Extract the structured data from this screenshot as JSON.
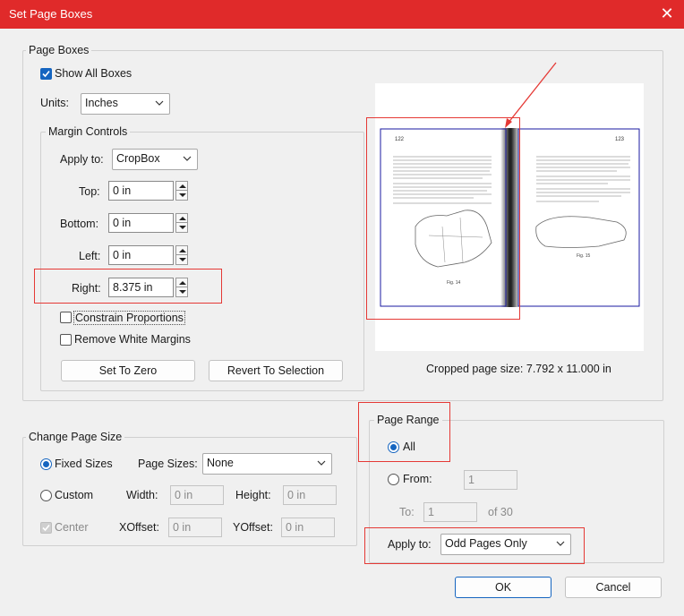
{
  "window": {
    "title": "Set Page Boxes"
  },
  "page_boxes": {
    "legend": "Page Boxes",
    "show_all_boxes": {
      "label": "Show All Boxes",
      "checked": true
    },
    "units": {
      "label": "Units:",
      "value": "Inches"
    },
    "margin_controls": {
      "legend": "Margin Controls",
      "apply_to": {
        "label": "Apply to:",
        "value": "CropBox"
      },
      "top": {
        "label": "Top:",
        "value": "0 in"
      },
      "bottom": {
        "label": "Bottom:",
        "value": "0 in"
      },
      "left": {
        "label": "Left:",
        "value": "0 in"
      },
      "right": {
        "label": "Right:",
        "value": "8.375 in"
      },
      "constrain": {
        "label": "Constrain Proportions",
        "checked": false
      },
      "remove_white": {
        "label": "Remove White Margins",
        "checked": false
      },
      "set_to_zero": "Set To Zero",
      "revert": "Revert To Selection"
    },
    "preview": {
      "cropped_size": "Cropped page size: 7.792 x 11.000 in",
      "left_page_number": "122",
      "right_page_number": "123",
      "left_caption": "Fig. 14",
      "right_caption": "Fig. 15"
    }
  },
  "change_page_size": {
    "legend": "Change Page Size",
    "fixed_sizes": {
      "label": "Fixed Sizes",
      "selected": true
    },
    "page_sizes": {
      "label": "Page Sizes:",
      "value": "None"
    },
    "custom": {
      "label": "Custom",
      "selected": false
    },
    "width": {
      "label": "Width:",
      "value": "0 in"
    },
    "height": {
      "label": "Height:",
      "value": "0 in"
    },
    "center": {
      "label": "Center",
      "checked": true
    },
    "xoffset": {
      "label": "XOffset:",
      "value": "0 in"
    },
    "yoffset": {
      "label": "YOffset:",
      "value": "0 in"
    }
  },
  "page_range": {
    "legend": "Page Range",
    "all": {
      "label": "All",
      "selected": true
    },
    "from": {
      "label": "From:",
      "value": "1"
    },
    "to": {
      "label": "To:",
      "value": "1"
    },
    "of": "of 30",
    "apply_to": {
      "label": "Apply to:",
      "value": "Odd Pages Only"
    }
  },
  "buttons": {
    "ok": "OK",
    "cancel": "Cancel"
  },
  "colors": {
    "titlebar": "#e02a2a",
    "accent": "#1565c0",
    "annotation": "#e53935",
    "box_outline": "#1a1aa0"
  }
}
